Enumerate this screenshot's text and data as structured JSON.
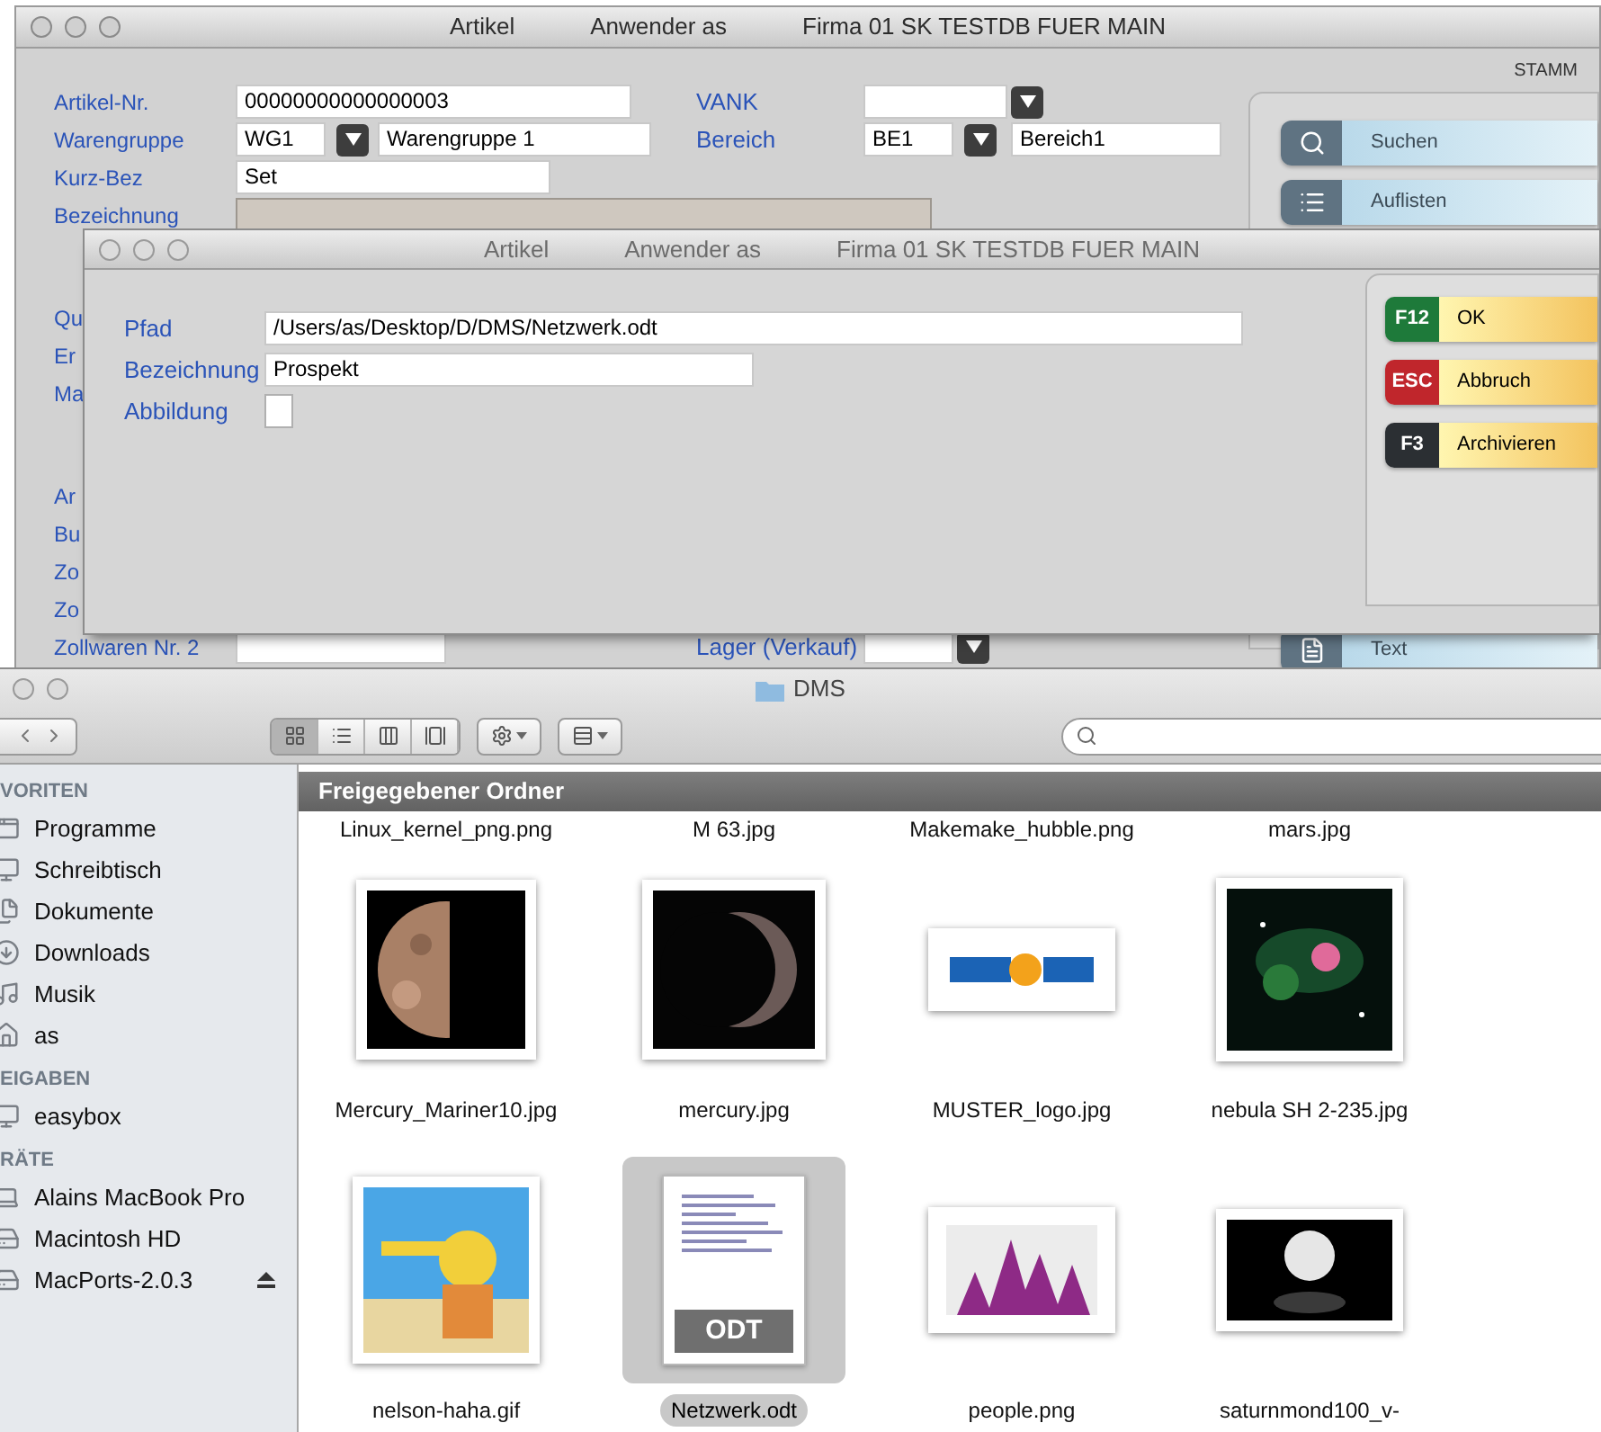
{
  "back_window": {
    "title_parts": [
      "Artikel",
      "Anwender as",
      "Firma 01 SK TESTDB FUER MAIN"
    ],
    "section": "STAMM",
    "form_groups": [
      [
        {
          "label": "Artikel-Nr.",
          "fields": [
            {
              "kind": "text",
              "value": "00000000000000003"
            }
          ],
          "right_label": "VANK",
          "right_fields": [
            {
              "kind": "select"
            }
          ]
        },
        {
          "label": "Warengruppe",
          "fields": [
            {
              "kind": "combo",
              "value": "WG1"
            },
            {
              "kind": "text",
              "value": "Warengruppe 1"
            }
          ],
          "right_label": "Bereich",
          "right_fields": [
            {
              "kind": "combo",
              "value": "BE1"
            },
            {
              "kind": "text",
              "value": "Bereich1"
            }
          ]
        },
        {
          "label": "Kurz-Bez",
          "fields": [
            {
              "kind": "text",
              "value": "Set"
            }
          ]
        },
        {
          "label": "Bezeichnung",
          "fields": [
            {
              "kind": "readonly"
            }
          ]
        }
      ],
      [
        {
          "label": "Qu"
        },
        {
          "label": "Er"
        },
        {
          "label": "Ma"
        }
      ],
      [
        {
          "label": "Ar"
        },
        {
          "label": "Bu"
        },
        {
          "label": "Zo"
        },
        {
          "label": "Zo"
        },
        {
          "label": "Zollwaren Nr. 2",
          "fields": [
            {
              "kind": "text"
            }
          ],
          "right_label": "Lager (Verkauf)",
          "right_fields": [
            {
              "kind": "select"
            }
          ]
        }
      ]
    ],
    "buttons": [
      {
        "label": "Suchen"
      },
      {
        "label": "Auflisten"
      }
    ],
    "bottom_button": {
      "label": "Text"
    }
  },
  "dialog": {
    "title_parts": [
      "Artikel",
      "Anwender as",
      "Firma 01 SK TESTDB FUER MAIN"
    ],
    "fields": [
      {
        "label": "Pfad",
        "kind": "text",
        "value": "/Users/as/Desktop/D/DMS/Netzwerk.odt"
      },
      {
        "label": "Bezeichnung",
        "kind": "text",
        "value": "Prospekt"
      },
      {
        "label": "Abbildung",
        "kind": "checkbox",
        "checked": false
      }
    ],
    "buttons": [
      {
        "key": "F12",
        "label": "OK",
        "color": "#1e7a3a"
      },
      {
        "key": "ESC",
        "label": "Abbruch",
        "color": "#c0262c"
      },
      {
        "key": "F3",
        "label": "Archivieren",
        "color": "#2b2f33"
      }
    ]
  },
  "finder": {
    "title": "DMS",
    "view_buttons": [
      {
        "selected": true
      },
      {
        "selected": false
      },
      {
        "selected": false
      },
      {
        "selected": false
      }
    ],
    "sidebar": [
      {
        "heading": "VORITEN",
        "items": [
          {
            "label": "Programme",
            "ejectable": false
          },
          {
            "label": "Schreibtisch",
            "ejectable": false
          },
          {
            "label": "Dokumente",
            "ejectable": false
          },
          {
            "label": "Downloads",
            "ejectable": false
          },
          {
            "label": "Musik",
            "ejectable": false
          },
          {
            "label": "as",
            "ejectable": false
          }
        ]
      },
      {
        "heading": "EIGABEN",
        "items": [
          {
            "label": "easybox",
            "ejectable": false
          }
        ]
      },
      {
        "heading": "RÄTE",
        "items": [
          {
            "label": "Alains MacBook Pro",
            "ejectable": false
          },
          {
            "label": "Macintosh HD",
            "ejectable": false
          },
          {
            "label": "MacPorts-2.0.3",
            "ejectable": true
          }
        ]
      }
    ],
    "header": "Freigegebener Ordner",
    "partial_row": [
      "Linux_kernel_png.png",
      "M 63.jpg",
      "Makemake_hubble.png",
      "mars.jpg"
    ],
    "files": [
      {
        "name": "Mercury_Mariner10.jpg",
        "kind": "picture",
        "selected": false
      },
      {
        "name": "mercury.jpg",
        "kind": "picture",
        "selected": false
      },
      {
        "name": "MUSTER_logo.jpg",
        "kind": "picture",
        "selected": false
      },
      {
        "name": "nebula SH 2-235.jpg",
        "kind": "picture",
        "selected": false
      },
      {
        "name": "nelson-haha.gif",
        "kind": "picture",
        "selected": false
      },
      {
        "name": "Netzwerk.odt",
        "kind": "document",
        "badge": "ODT",
        "selected": true
      },
      {
        "name": "people.png",
        "kind": "picture",
        "selected": false
      },
      {
        "name": "saturnmond100_v-",
        "kind": "picture",
        "selected": false
      }
    ]
  }
}
